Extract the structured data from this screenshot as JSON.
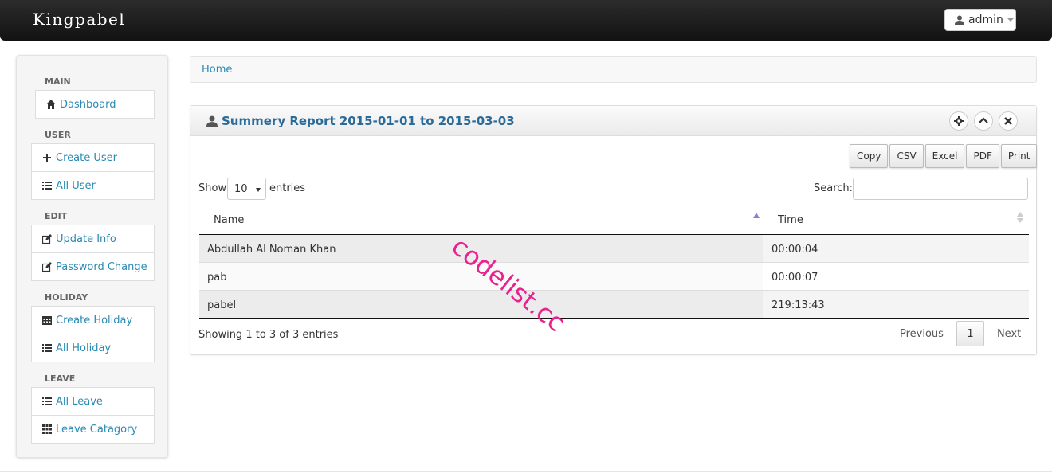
{
  "navbar": {
    "brand": "Kingpabel",
    "user_label": "admin"
  },
  "sidebar": {
    "sections": [
      {
        "header": "MAIN",
        "items": [
          {
            "label": "Dashboard",
            "icon": "home-icon"
          }
        ]
      },
      {
        "header": "USER",
        "items": [
          {
            "label": "Create User",
            "icon": "plus-icon"
          },
          {
            "label": "All User",
            "icon": "list-icon"
          }
        ]
      },
      {
        "header": "EDIT",
        "items": [
          {
            "label": "Update Info",
            "icon": "edit-icon"
          },
          {
            "label": "Password Change",
            "icon": "edit-icon"
          }
        ]
      },
      {
        "header": "HOLIDAY",
        "items": [
          {
            "label": "Create Holiday",
            "icon": "calendar-icon"
          },
          {
            "label": "All Holiday",
            "icon": "list-icon"
          }
        ]
      },
      {
        "header": "LEAVE",
        "items": [
          {
            "label": "All Leave",
            "icon": "list-icon"
          },
          {
            "label": "Leave Catagory",
            "icon": "grid-icon"
          }
        ]
      }
    ]
  },
  "breadcrumb": {
    "home": "Home"
  },
  "report": {
    "title": "Summery Report 2015-01-01 to 2015-03-03",
    "export_buttons": [
      "Copy",
      "CSV",
      "Excel",
      "PDF",
      "Print"
    ],
    "length": {
      "show": "Show",
      "value": "10",
      "entries": "entries"
    },
    "search_label": "Search:",
    "search_value": "",
    "columns": [
      "Name",
      "Time"
    ],
    "rows": [
      {
        "name": "Abdullah Al Noman Khan",
        "time": "00:00:04"
      },
      {
        "name": "pab",
        "time": "00:00:07"
      },
      {
        "name": "pabel",
        "time": "219:13:43"
      }
    ],
    "info": "Showing 1 to 3 of 3 entries",
    "pagination": {
      "previous": "Previous",
      "current": "1",
      "next": "Next"
    }
  },
  "watermark": "codelist.cc",
  "colors": {
    "link": "#2a8ab3",
    "title": "#2a6b99",
    "watermark": "#e8228f"
  }
}
